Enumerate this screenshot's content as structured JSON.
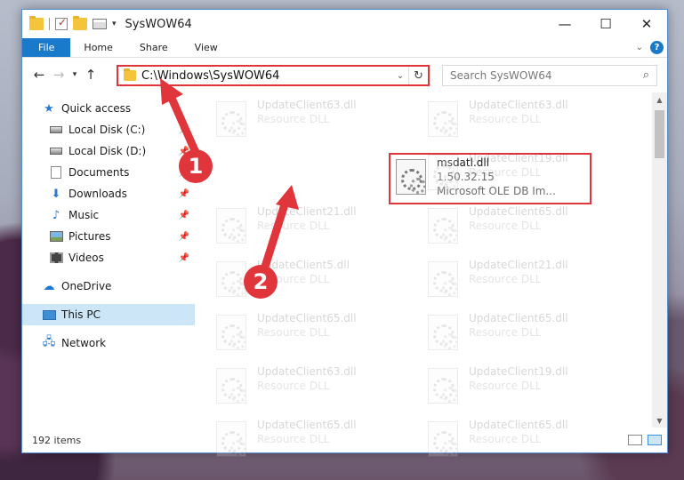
{
  "window": {
    "title": "SysWOW64",
    "controls": {
      "minimize": "—",
      "maximize": "☐",
      "close": "✕"
    }
  },
  "ribbon": {
    "tabs": [
      {
        "label": "File"
      },
      {
        "label": "Home"
      },
      {
        "label": "Share"
      },
      {
        "label": "View"
      }
    ],
    "help": "?"
  },
  "nav": {
    "address": "C:\\Windows\\SysWOW64",
    "search_placeholder": "Search SysWOW64"
  },
  "sidebar": {
    "items": [
      {
        "label": "Quick access",
        "icon": "star-icon"
      },
      {
        "label": "Local Disk (C:)",
        "icon": "drive-icon",
        "pinned": true
      },
      {
        "label": "Local Disk (D:)",
        "icon": "drive-icon",
        "pinned": true
      },
      {
        "label": "Documents",
        "icon": "documents-icon",
        "pinned": true
      },
      {
        "label": "Downloads",
        "icon": "downloads-icon",
        "pinned": true
      },
      {
        "label": "Music",
        "icon": "music-icon",
        "pinned": true
      },
      {
        "label": "Pictures",
        "icon": "pictures-icon",
        "pinned": true
      },
      {
        "label": "Videos",
        "icon": "videos-icon",
        "pinned": true
      },
      {
        "label": "OneDrive",
        "icon": "onedrive-icon"
      },
      {
        "label": "This PC",
        "icon": "this-pc-icon",
        "selected": true
      },
      {
        "label": "Network",
        "icon": "network-icon"
      }
    ]
  },
  "files": {
    "left_col": [
      {
        "name": "UpdateClient63.dll",
        "sub": "Resource DLL"
      },
      {
        "name": "msdatl.dll",
        "sub": "1.50.32.15",
        "desc": "Microsoft OLE DB Im..."
      },
      {
        "name": "UpdateClient21.dll",
        "sub": "Resource DLL"
      },
      {
        "name": "UpdateClient5.dll",
        "sub": "Resource DLL"
      },
      {
        "name": "UpdateClient65.dll",
        "sub": "Resource DLL"
      },
      {
        "name": "UpdateClient63.dll",
        "sub": "Resource DLL"
      },
      {
        "name": "UpdateClient65.dll",
        "sub": "Resource DLL"
      }
    ],
    "right_col": [
      {
        "name": "UpdateClient63.dll",
        "sub": "Resource DLL"
      },
      {
        "name": "UpdateClient19.dll",
        "sub": "Resource DLL"
      },
      {
        "name": "UpdateClient65.dll",
        "sub": "Resource DLL"
      },
      {
        "name": "UpdateClient21.dll",
        "sub": "Resource DLL"
      },
      {
        "name": "UpdateClient65.dll",
        "sub": "Resource DLL"
      },
      {
        "name": "UpdateClient19.dll",
        "sub": "Resource DLL"
      },
      {
        "name": "UpdateClient65.dll",
        "sub": "Resource DLL"
      }
    ]
  },
  "status": {
    "items": "192 items"
  },
  "callouts": [
    "1",
    "2"
  ],
  "colors": {
    "accent": "#1979ca",
    "highlight": "#e0353b",
    "selected": "#cde6f7"
  }
}
